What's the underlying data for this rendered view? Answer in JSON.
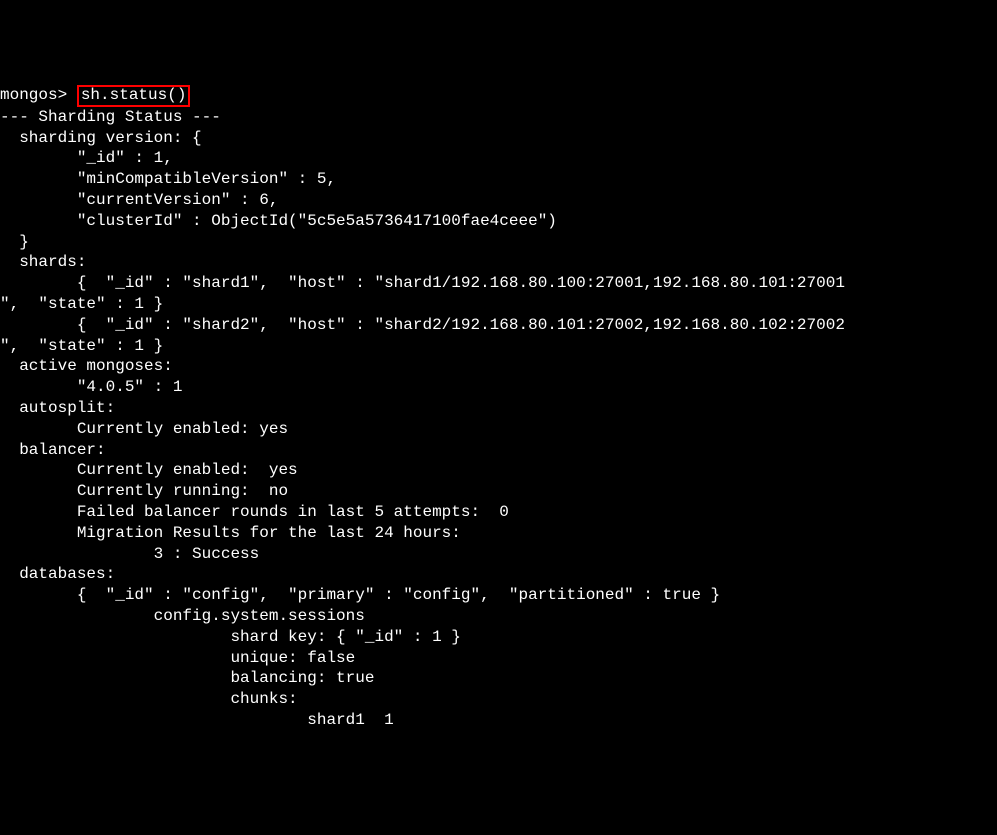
{
  "prompt": "mongos> ",
  "command": "sh.status()",
  "lines": [
    "--- Sharding Status ---",
    "  sharding version: {",
    "        \"_id\" : 1,",
    "        \"minCompatibleVersion\" : 5,",
    "        \"currentVersion\" : 6,",
    "        \"clusterId\" : ObjectId(\"5c5e5a5736417100fae4ceee\")",
    "  }",
    "  shards:",
    "        {  \"_id\" : \"shard1\",  \"host\" : \"shard1/192.168.80.100:27001,192.168.80.101:27001",
    "\",  \"state\" : 1 }",
    "        {  \"_id\" : \"shard2\",  \"host\" : \"shard2/192.168.80.101:27002,192.168.80.102:27002",
    "\",  \"state\" : 1 }",
    "  active mongoses:",
    "        \"4.0.5\" : 1",
    "  autosplit:",
    "        Currently enabled: yes",
    "  balancer:",
    "        Currently enabled:  yes",
    "        Currently running:  no",
    "        Failed balancer rounds in last 5 attempts:  0",
    "        Migration Results for the last 24 hours:",
    "                3 : Success",
    "  databases:",
    "        {  \"_id\" : \"config\",  \"primary\" : \"config\",  \"partitioned\" : true }",
    "                config.system.sessions",
    "                        shard key: { \"_id\" : 1 }",
    "                        unique: false",
    "                        balancing: true",
    "                        chunks:",
    "                                shard1  1"
  ]
}
